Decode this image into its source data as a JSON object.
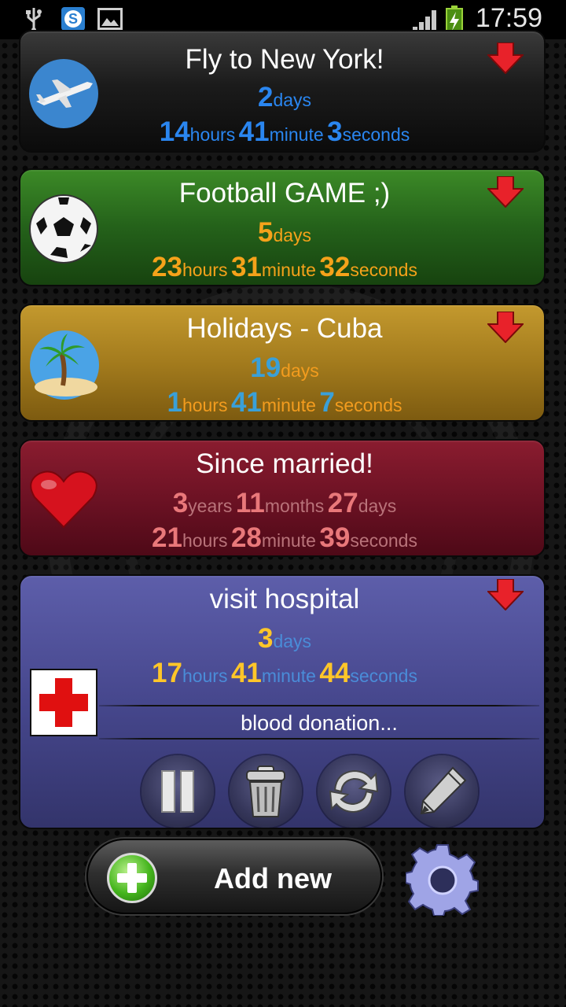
{
  "status_bar": {
    "time": "17:59",
    "icons": [
      "usb-icon",
      "skype-icon",
      "image-icon",
      "signal-icon",
      "battery-charging-icon"
    ]
  },
  "events": [
    {
      "title": "Fly to New York!",
      "icon": "airplane-icon",
      "line1": [
        {
          "n": "2",
          "u": "days"
        }
      ],
      "line2": [
        {
          "n": "14",
          "u": "hours"
        },
        {
          "n": "41",
          "u": "minute"
        },
        {
          "n": "3",
          "u": "seconds"
        }
      ]
    },
    {
      "title": "Football GAME ;)",
      "icon": "soccer-ball-icon",
      "line1": [
        {
          "n": "5",
          "u": "days"
        }
      ],
      "line2": [
        {
          "n": "23",
          "u": "hours"
        },
        {
          "n": "31",
          "u": "minute"
        },
        {
          "n": "32",
          "u": "seconds"
        }
      ]
    },
    {
      "title": "Holidays - Cuba",
      "icon": "palm-island-icon",
      "line1": [
        {
          "n": "19",
          "u": "days"
        }
      ],
      "line2": [
        {
          "n": "1",
          "u": "hours"
        },
        {
          "n": "41",
          "u": "minute"
        },
        {
          "n": "7",
          "u": "seconds"
        }
      ]
    },
    {
      "title": "Since married!",
      "icon": "heart-icon",
      "line1": [
        {
          "n": "3",
          "u": "years"
        },
        {
          "n": "11",
          "u": "months"
        },
        {
          "n": "27",
          "u": "days"
        }
      ],
      "line2": [
        {
          "n": "21",
          "u": "hours"
        },
        {
          "n": "28",
          "u": "minute"
        },
        {
          "n": "39",
          "u": "seconds"
        }
      ]
    },
    {
      "title": "visit hospital",
      "icon": "red-cross-icon",
      "line1": [
        {
          "n": "3",
          "u": "days"
        }
      ],
      "line2": [
        {
          "n": "17",
          "u": "hours"
        },
        {
          "n": "41",
          "u": "minute"
        },
        {
          "n": "44",
          "u": "seconds"
        }
      ],
      "note": "blood donation..."
    }
  ],
  "controls": [
    "pause-icon",
    "trash-icon",
    "refresh-icon",
    "edit-pencil-icon"
  ],
  "footer": {
    "add_label": "Add new"
  }
}
